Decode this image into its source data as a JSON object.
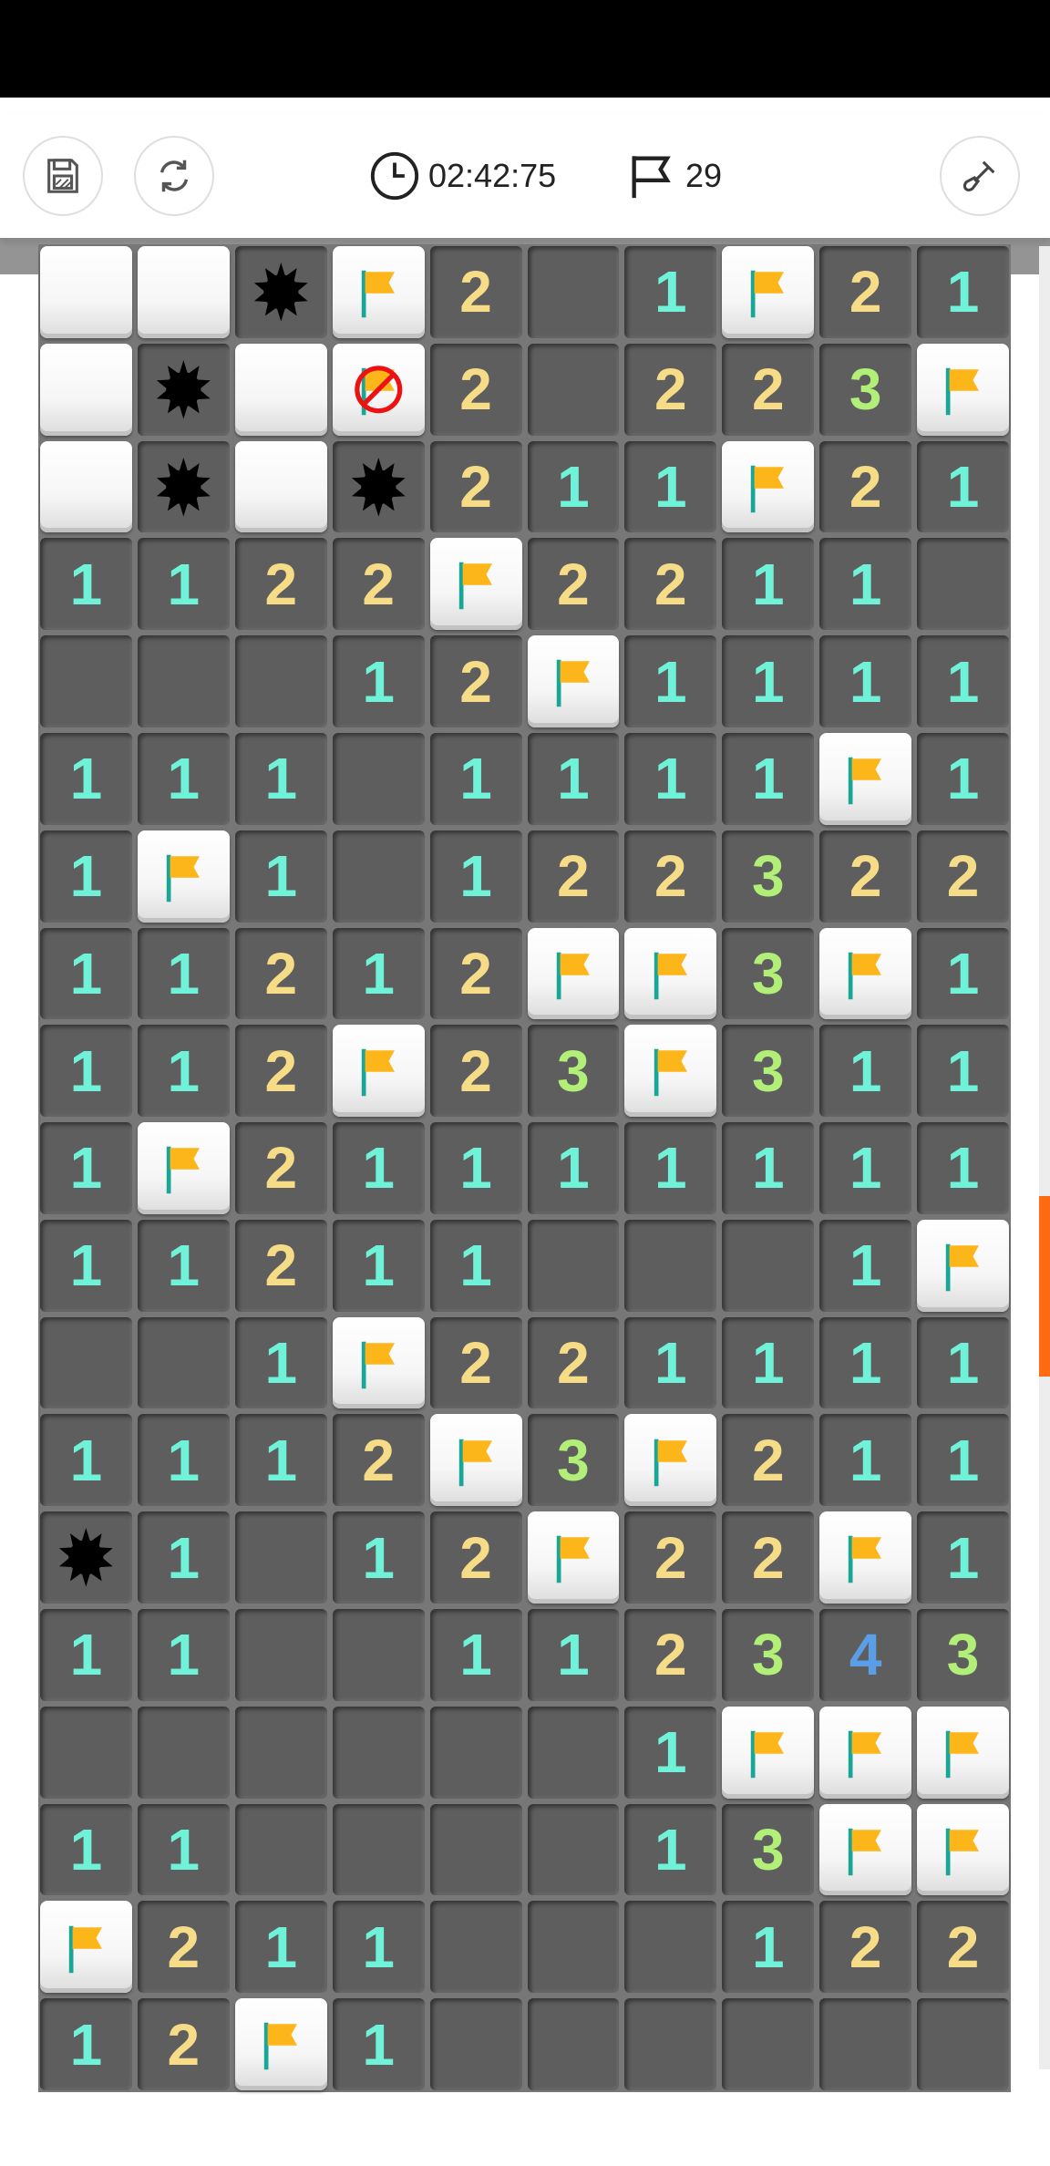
{
  "toolbar": {
    "save_icon": "save-icon",
    "restart_icon": "restart-icon",
    "timer": "02:42:75",
    "timer_icon": "clock-icon",
    "flags_remaining": "29",
    "flag_counter_icon": "flag-outline-icon",
    "tool_icon": "shovel-icon"
  },
  "colors": {
    "number_1": "#6ff2d8",
    "number_2": "#f7dc88",
    "number_3": "#b2ef78",
    "number_4": "#5b9ee8",
    "flag": "#fcb61a",
    "scroll_thumb": "#ff6a13"
  },
  "legend": {
    "C": "closed",
    "F": "flag",
    "X": "wrong-flag",
    "M": "mine",
    "0": "empty",
    "1-8": "number"
  },
  "board": {
    "columns": 10,
    "rows": [
      [
        "C",
        "C",
        "M",
        "F",
        "2",
        "0",
        "1",
        "F",
        "2",
        "1"
      ],
      [
        "C",
        "M",
        "C",
        "X",
        "2",
        "0",
        "2",
        "2",
        "3",
        "F"
      ],
      [
        "C",
        "M",
        "C",
        "M",
        "2",
        "1",
        "1",
        "F",
        "2",
        "1"
      ],
      [
        "1",
        "1",
        "2",
        "2",
        "F",
        "2",
        "2",
        "1",
        "1",
        "0"
      ],
      [
        "0",
        "0",
        "0",
        "1",
        "2",
        "F",
        "1",
        "1",
        "1",
        "1"
      ],
      [
        "1",
        "1",
        "1",
        "0",
        "1",
        "1",
        "1",
        "1",
        "F",
        "1"
      ],
      [
        "1",
        "F",
        "1",
        "0",
        "1",
        "2",
        "2",
        "3",
        "2",
        "2"
      ],
      [
        "1",
        "1",
        "2",
        "1",
        "2",
        "F",
        "F",
        "3",
        "F",
        "1"
      ],
      [
        "1",
        "1",
        "2",
        "F",
        "2",
        "3",
        "F",
        "3",
        "1",
        "1"
      ],
      [
        "1",
        "F",
        "2",
        "1",
        "1",
        "1",
        "1",
        "1",
        "1",
        "1"
      ],
      [
        "1",
        "1",
        "2",
        "1",
        "1",
        "0",
        "0",
        "0",
        "1",
        "F"
      ],
      [
        "0",
        "0",
        "1",
        "F",
        "2",
        "2",
        "1",
        "1",
        "1",
        "1"
      ],
      [
        "1",
        "1",
        "1",
        "2",
        "F",
        "3",
        "F",
        "2",
        "1",
        "1"
      ],
      [
        "M",
        "1",
        "0",
        "1",
        "2",
        "F",
        "2",
        "2",
        "F",
        "1"
      ],
      [
        "1",
        "1",
        "0",
        "0",
        "1",
        "1",
        "2",
        "3",
        "4",
        "3"
      ],
      [
        "0",
        "0",
        "0",
        "0",
        "0",
        "0",
        "1",
        "F",
        "F",
        "F"
      ],
      [
        "1",
        "1",
        "0",
        "0",
        "0",
        "0",
        "1",
        "3",
        "F",
        "F"
      ],
      [
        "F",
        "2",
        "1",
        "1",
        "0",
        "0",
        "0",
        "1",
        "2",
        "2"
      ],
      [
        "1",
        "2",
        "F",
        "1",
        "0",
        "0",
        "0",
        "0",
        "0",
        "0"
      ]
    ]
  }
}
